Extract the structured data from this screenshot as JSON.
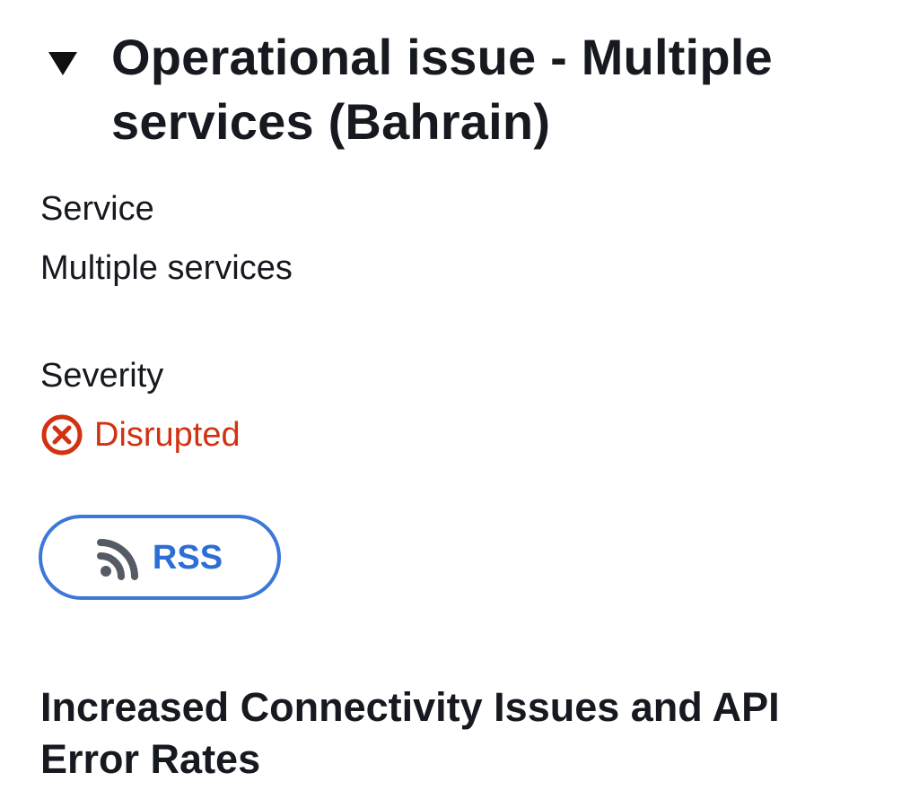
{
  "issue": {
    "title": "Operational issue - Multiple services (Bahrain)",
    "expanded": true,
    "toggle_icon": "triangle-down-icon"
  },
  "service": {
    "label": "Service",
    "value": "Multiple services"
  },
  "severity": {
    "label": "Severity",
    "value": "Disrupted",
    "icon": "error-circle-icon",
    "color": "#d13212"
  },
  "rss": {
    "label": "RSS",
    "icon": "rss-icon",
    "accent_color": "#2c6ed5"
  },
  "event": {
    "title": "Increased Connectivity Issues and API Error Rates"
  }
}
